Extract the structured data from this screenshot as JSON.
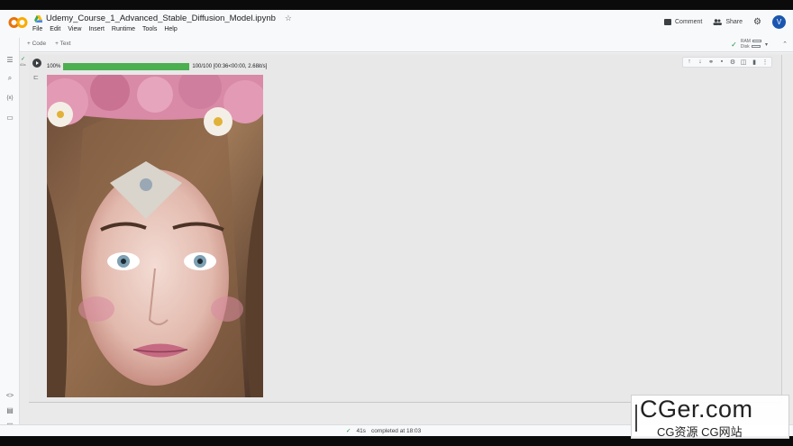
{
  "header": {
    "title": "Udemy_Course_1_Advanced_Stable_Diffusion_Model.ipynb",
    "menus": [
      "File",
      "Edit",
      "View",
      "Insert",
      "Runtime",
      "Tools",
      "Help"
    ],
    "comment_label": "Comment",
    "share_label": "Share",
    "avatar_letter": "V"
  },
  "toolbar": {
    "add_code": "+ Code",
    "add_text": "+ Text",
    "ram_label": "RAM",
    "disk_label": "Disk"
  },
  "cell": {
    "exec_time": "41s",
    "progress_percent_label": "100%",
    "progress_fraction": 1.0,
    "progress_stats": "100/100 [00:36<00:00, 2.68it/s]"
  },
  "status": {
    "duration": "41s",
    "completed_text": "completed at 18:03"
  },
  "watermark": {
    "main": "CGer.com",
    "sub": "CG资源 CG网站"
  },
  "colors": {
    "progress": "#4caf50",
    "avatar": "#1a56b0",
    "logo_orange": "#f9ab00",
    "logo_dark_orange": "#e8710a"
  }
}
